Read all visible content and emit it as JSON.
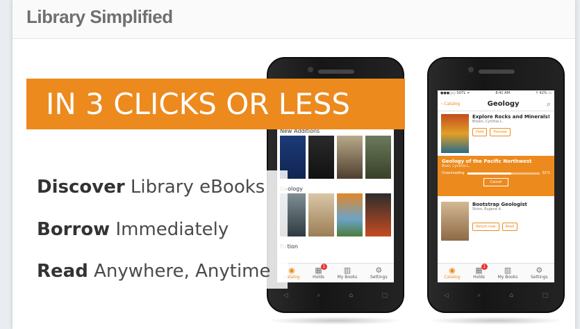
{
  "header": {
    "brand": "Library Simplified"
  },
  "banner": {
    "text": "IN 3 CLICKS OR LESS",
    "color": "#ec8a1e"
  },
  "features": [
    {
      "bold": "Discover",
      "rest": " Library eBooks"
    },
    {
      "bold": "Borrow",
      "rest": " Immediately"
    },
    {
      "bold": "Read",
      "rest": " Anywhere, Anytime"
    }
  ],
  "phone1": {
    "sections": [
      "New Additions",
      "Geology",
      "Fiction"
    ],
    "tabs": [
      {
        "label": "Catalog",
        "icon": "catalog-icon"
      },
      {
        "label": "Holds",
        "icon": "holds-icon",
        "badge": "1"
      },
      {
        "label": "My Books",
        "icon": "mybooks-icon"
      },
      {
        "label": "Settings",
        "icon": "settings-icon"
      }
    ]
  },
  "phone2": {
    "status_left": "●●●○○ SOTL  ᯤ",
    "status_time": "8:41 AM",
    "status_right": "↑ 42% ▭",
    "back": "Catalog",
    "title": "Geology",
    "item1": {
      "title": "Explore Rocks and Minerals!",
      "author": "Brown, Cynthia L.",
      "btn1": "Hold",
      "btn2": "Preview"
    },
    "download": {
      "title": "Geology of the Pacific Northwest",
      "author": "Bisel, Cynthia L.",
      "status": "Downloading",
      "percent_label": "61%",
      "progress": 0.61,
      "cancel": "Cancel"
    },
    "item2": {
      "title": "Bootstrap Geologist",
      "author": "Shinn, Eugene A.",
      "btn1": "Return now",
      "btn2": "Read"
    },
    "tabs": [
      {
        "label": "Catalog",
        "icon": "catalog-icon"
      },
      {
        "label": "Holds",
        "icon": "holds-icon",
        "badge": "1"
      },
      {
        "label": "My Books",
        "icon": "mybooks-icon"
      },
      {
        "label": "Settings",
        "icon": "settings-icon"
      }
    ]
  }
}
